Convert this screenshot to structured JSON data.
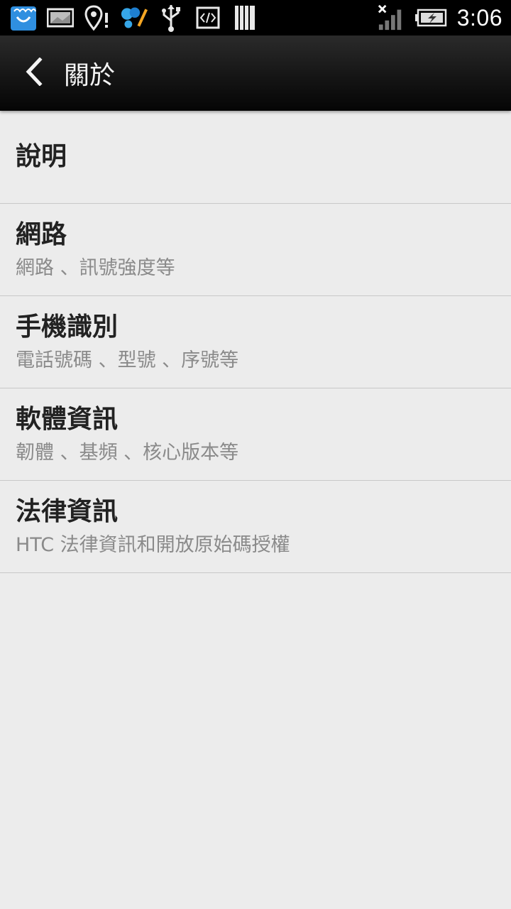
{
  "status_bar": {
    "icons_left": [
      "store-icon",
      "image-icon",
      "location-alert-icon",
      "sync-app-icon",
      "usb-icon",
      "code-icon",
      "barcode-icon"
    ],
    "icons_right": [
      "signal-no-service-icon",
      "battery-charging-icon"
    ],
    "time": "3:06"
  },
  "action_bar": {
    "title": "關於"
  },
  "list": {
    "items": [
      {
        "title": "說明",
        "subtitle": ""
      },
      {
        "title": "網路",
        "subtitle": "網路 、訊號強度等"
      },
      {
        "title": "手機識別",
        "subtitle": "電話號碼 、型號 、序號等"
      },
      {
        "title": "軟體資訊",
        "subtitle": "韌體 、基頻 、核心版本等"
      },
      {
        "title": "法律資訊",
        "subtitle": "HTC 法律資訊和開放原始碼授權"
      }
    ]
  },
  "colors": {
    "background": "#ececec",
    "divider": "#c8c8c8",
    "title_text": "#222222",
    "subtitle_text": "#8a8a8a",
    "status_bar": "#000000"
  }
}
